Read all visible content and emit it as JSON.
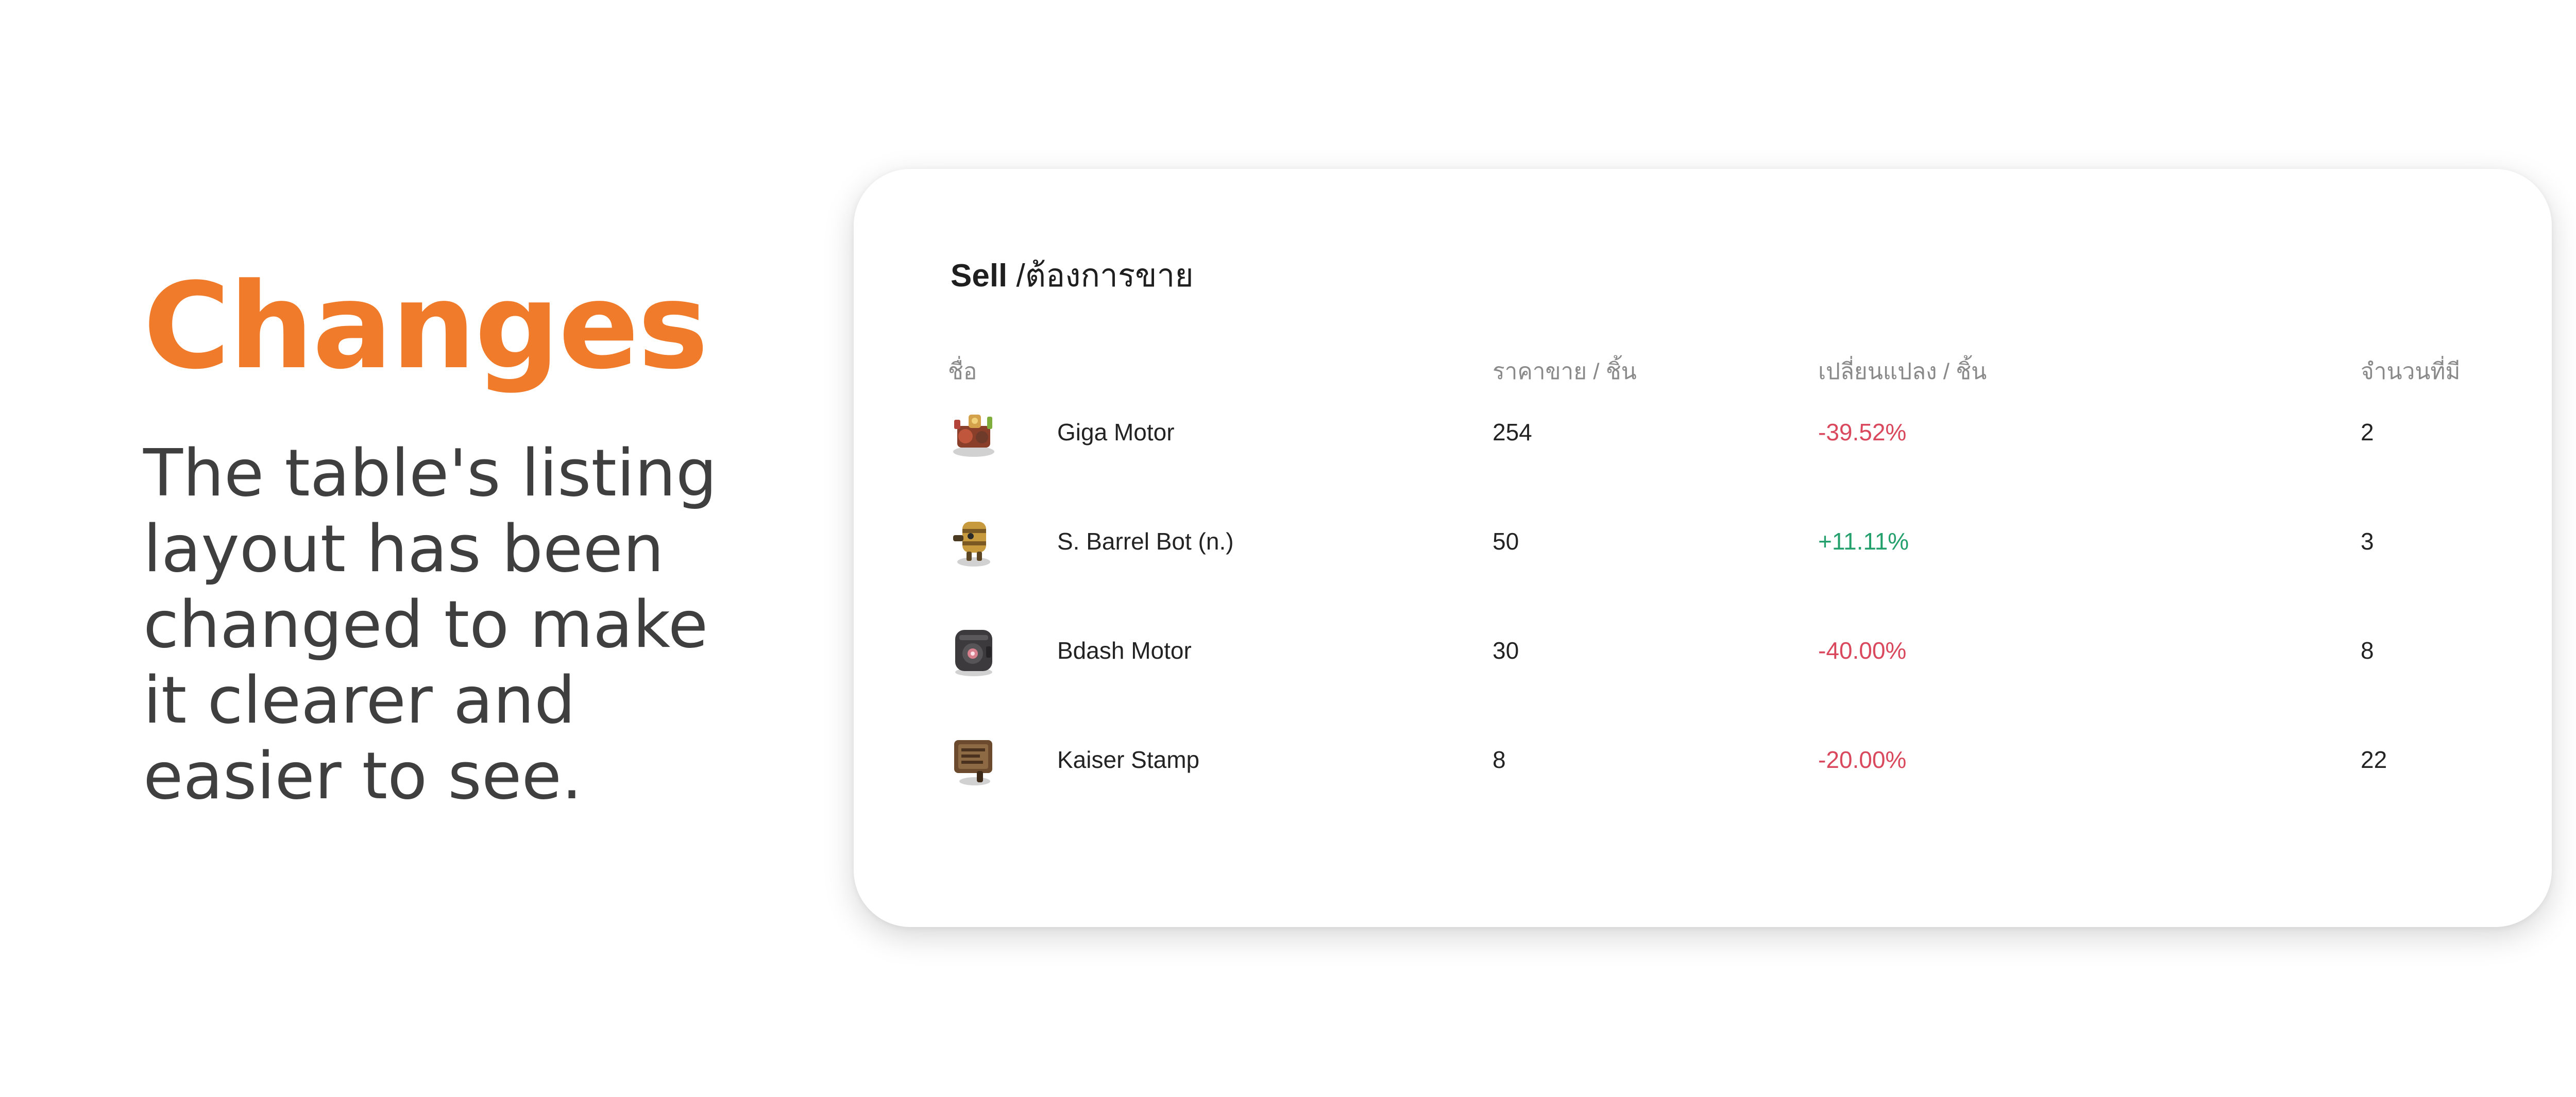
{
  "left": {
    "headline": "Changes",
    "description": "The table's listing\nlayout has been\nchanged to make\nit clearer and\neasier to see."
  },
  "card": {
    "title_bold": "Sell",
    "title_rest": " /ต้องการขาย",
    "columns": {
      "name": "ชื่อ",
      "price": "ราคาขาย / ชิ้น",
      "change": "เปลี่ยนแปลง / ชิ้น",
      "quantity": "จำนวนที่มี"
    },
    "rows": [
      {
        "name": "Giga Motor",
        "price": "254",
        "change": "-39.52%",
        "quantity": "2",
        "icon": "giga-motor-item-icon"
      },
      {
        "name": "S. Barrel Bot (n.)",
        "price": "50",
        "change": "+11.11%",
        "quantity": "3",
        "icon": "barrel-bot-item-icon"
      },
      {
        "name": "Bdash Motor",
        "price": "30",
        "change": "-40.00%",
        "quantity": "8",
        "icon": "bdash-motor-item-icon"
      },
      {
        "name": "Kaiser Stamp",
        "price": "8",
        "change": "-20.00%",
        "quantity": "22",
        "icon": "kaiser-stamp-item-icon"
      }
    ]
  },
  "colors": {
    "accent": "#f07b2b",
    "negative": "#d9485c",
    "positive": "#23a06b"
  }
}
